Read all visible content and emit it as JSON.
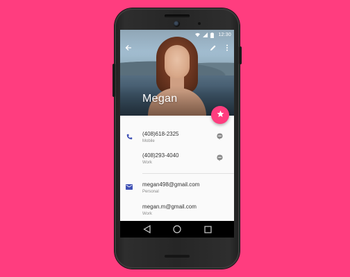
{
  "status_bar": {
    "time": "12:30"
  },
  "toolbar": {
    "back_icon": "arrow-back-icon",
    "edit_icon": "pencil-icon",
    "more_icon": "more-vert-icon"
  },
  "contact": {
    "name": "Megan"
  },
  "fab": {
    "icon": "star-icon",
    "color": "#ff3d7f"
  },
  "phones": [
    {
      "number": "(408)618-2325",
      "type": "Mobile"
    },
    {
      "number": "(408)293-4040",
      "type": "Work"
    }
  ],
  "emails": [
    {
      "address": "megan498@gmail.com",
      "type": "Personal"
    },
    {
      "address": "megan.m@gmail.com",
      "type": "Work"
    }
  ],
  "colors": {
    "background": "#ff3d7f",
    "accent": "#ff3d7f",
    "phone_icon": "#3f51b5",
    "email_icon": "#3f51b5"
  }
}
